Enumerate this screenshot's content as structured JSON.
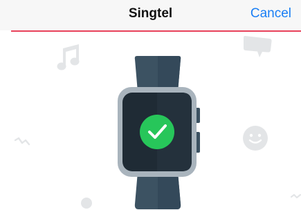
{
  "navbar": {
    "title": "Singtel",
    "cancel_label": "Cancel"
  },
  "colors": {
    "accent": "#e8415a",
    "link": "#1a7ff5",
    "success": "#27c65a",
    "watch_body": "#3c5262",
    "watch_frame": "#a9b4bd",
    "decor": "#e3e5e7"
  },
  "illustration": {
    "device": "watch-icon",
    "status_icon": "checkmark-icon",
    "decorations": [
      "music-note-icon",
      "chat-bubble-icon",
      "smiley-icon",
      "squiggle-icon",
      "dot-icon"
    ]
  }
}
